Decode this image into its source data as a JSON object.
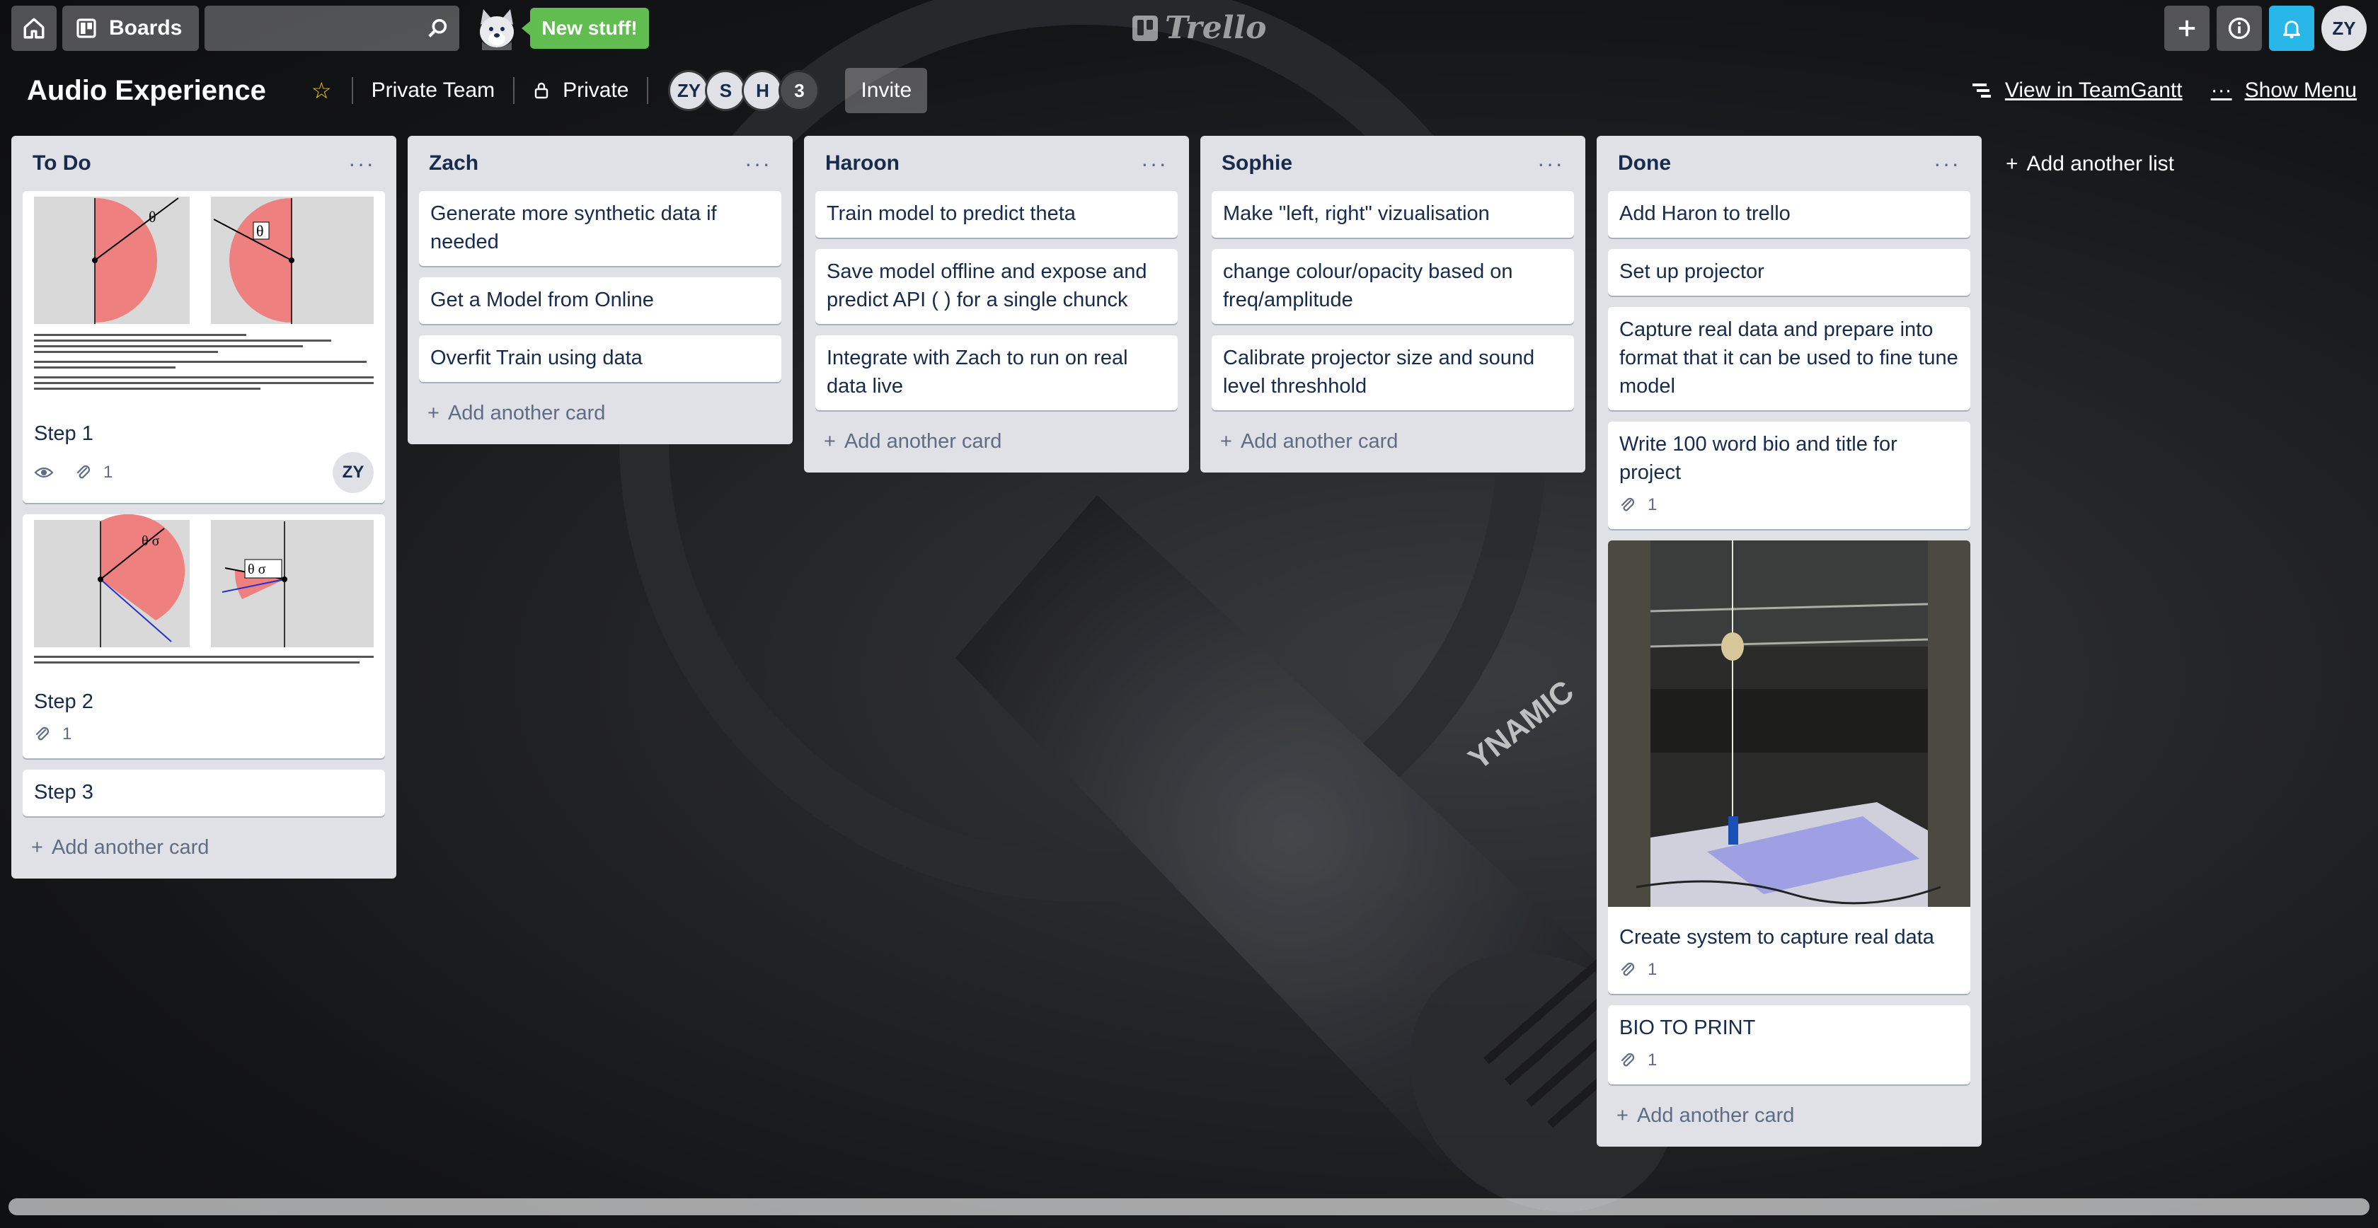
{
  "header": {
    "boards_label": "Boards",
    "search_value": "",
    "new_stuff_label": "New stuff!",
    "logo_text": "Trello",
    "user_initials": "ZY"
  },
  "board": {
    "title": "Audio Experience",
    "team_label": "Private Team",
    "visibility_label": "Private",
    "members": [
      "ZY",
      "S",
      "H"
    ],
    "member_overflow": "3",
    "invite_label": "Invite",
    "teamgantt_label": "View in TeamGantt",
    "menu_label": "Show Menu",
    "add_list_label": "Add another list"
  },
  "lists": [
    {
      "title": "To Do",
      "add_card_label": "Add another card",
      "cards": [
        {
          "title": "Step 1",
          "watch": true,
          "attachments": "1",
          "member": "ZY",
          "cover": "diagram1"
        },
        {
          "title": "Step 2",
          "attachments": "1",
          "cover": "diagram2"
        },
        {
          "title": "Step 3"
        }
      ]
    },
    {
      "title": "Zach",
      "add_card_label": "Add another card",
      "cards": [
        {
          "title": "Generate more synthetic data if needed"
        },
        {
          "title": "Get a Model from Online"
        },
        {
          "title": "Overfit Train using data"
        }
      ]
    },
    {
      "title": "Haroon",
      "add_card_label": "Add another card",
      "cards": [
        {
          "title": "Train model to predict theta"
        },
        {
          "title": "Save model offline and expose and predict API ( ) for a single chunck"
        },
        {
          "title": "Integrate with Zach to run on real data live"
        }
      ]
    },
    {
      "title": "Sophie",
      "add_card_label": "Add another card",
      "cards": [
        {
          "title": "Make \"left, right\" vizualisation"
        },
        {
          "title": "change colour/opacity based on freq/amplitude"
        },
        {
          "title": "Calibrate projector size and sound level threshhold"
        }
      ]
    },
    {
      "title": "Done",
      "add_card_label": "Add another card",
      "cards": [
        {
          "title": "Add Haron to trello"
        },
        {
          "title": "Set up projector"
        },
        {
          "title": "Capture real data and prepare into format that it can be used to fine tune model"
        },
        {
          "title": "Write 100 word bio and title for project",
          "attachments": "1"
        },
        {
          "title": "Create system to capture real data",
          "attachments": "1",
          "cover": "photo"
        },
        {
          "title": "BIO TO PRINT",
          "attachments": "1"
        }
      ]
    }
  ],
  "icons": {
    "home": "home-icon",
    "boards": "boards-icon",
    "search": "search-icon",
    "plus": "plus-icon",
    "info": "info-icon",
    "bell": "bell-icon",
    "star": "star-icon",
    "lock": "lock-icon",
    "eye": "eye-icon",
    "paperclip": "paperclip-icon",
    "more": "more-icon",
    "gantt": "gantt-icon"
  }
}
